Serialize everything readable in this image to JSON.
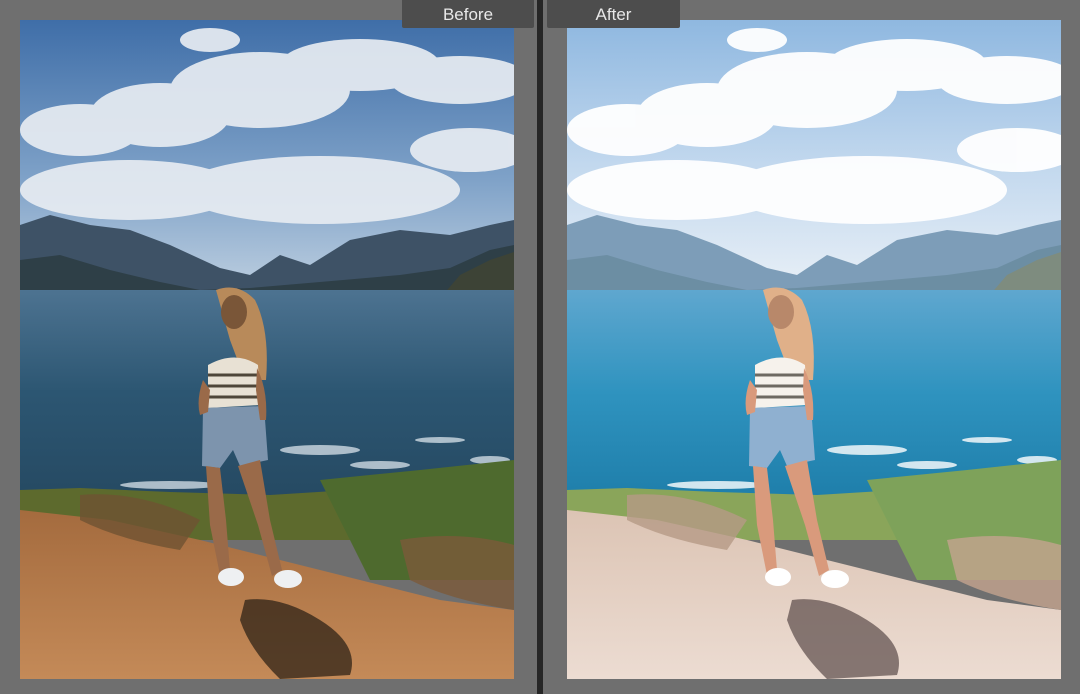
{
  "views": {
    "before": {
      "label": "Before"
    },
    "after": {
      "label": "After"
    }
  },
  "colors": {
    "background": "#6f6f6f",
    "divider": "#262626",
    "label_tab": "#4d4d4d",
    "label_text": "#e8e8e8"
  }
}
